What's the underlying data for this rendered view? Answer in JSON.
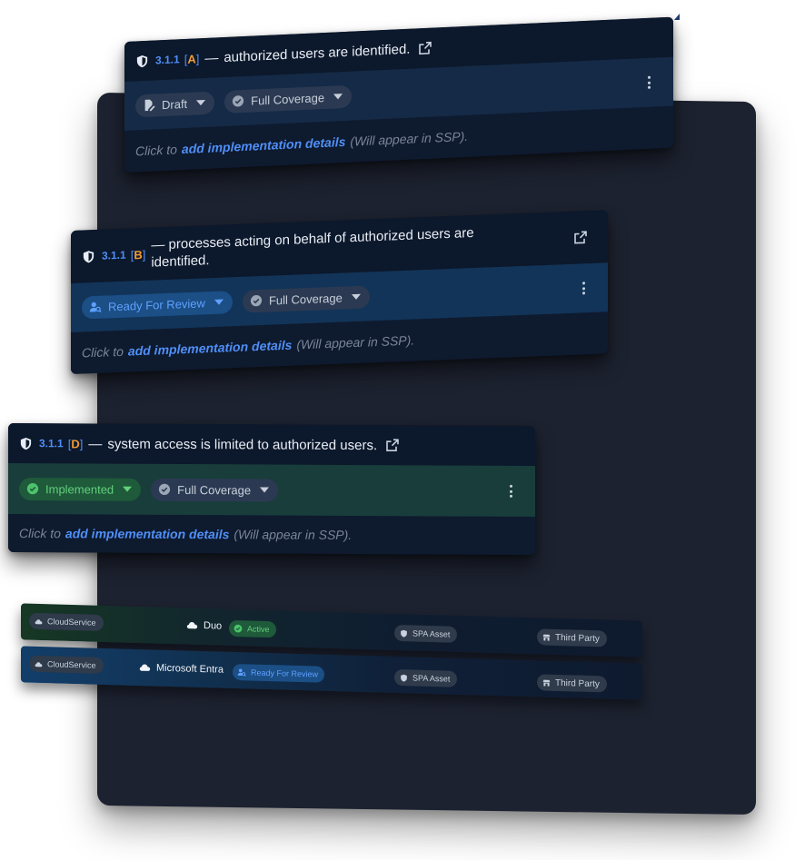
{
  "controls": [
    {
      "id": "3.1.1",
      "letter": "A",
      "title": "authorized users are identified.",
      "status": "Draft",
      "coverage": "Full Coverage",
      "details_prefix": "Click to",
      "details_link": "add implementation details",
      "details_suffix": "(Will appear in SSP)."
    },
    {
      "id": "3.1.1",
      "letter": "B",
      "title": "processes acting on behalf of authorized users are identified.",
      "title_line1": "processes acting on behalf of authorized users are",
      "title_line2": "identified.",
      "status": "Ready For Review",
      "coverage": "Full Coverage",
      "details_prefix": "Click to",
      "details_link": "add implementation details",
      "details_suffix": "(Will appear in SSP)."
    },
    {
      "id": "3.1.1",
      "letter": "D",
      "title": "system access is limited to authorized users.",
      "status": "Implemented",
      "coverage": "Full Coverage",
      "details_prefix": "Click to",
      "details_link": "add implementation details",
      "details_suffix": "(Will appear in SSP)."
    }
  ],
  "symbols": {
    "dash": "—",
    "open_bracket": "[",
    "close_bracket": "]"
  },
  "assets": [
    {
      "type": "CloudService",
      "name": "Duo",
      "status": "Active",
      "category": "SPA Asset",
      "provider": "Third Party"
    },
    {
      "type": "CloudService",
      "name": "Microsoft Entra",
      "status": "Ready For Review",
      "category": "SPA Asset",
      "provider": "Third Party"
    }
  ],
  "colors": {
    "panel": "#1d2230",
    "card": "#0e1a2e",
    "accent_blue": "#4f8ff7",
    "accent_orange": "#f29b38",
    "implemented_green": "#4cc36b",
    "review_blue": "#4f8ff7"
  },
  "icons": {
    "shield": "shield-icon",
    "external": "external-link-icon",
    "draft": "draft-edit-icon",
    "coverage": "check-circle-icon",
    "review": "user-review-icon",
    "implemented": "check-circle-icon",
    "kebab": "kebab-menu-icon",
    "cloud": "cloud-icon",
    "store": "store-icon"
  }
}
